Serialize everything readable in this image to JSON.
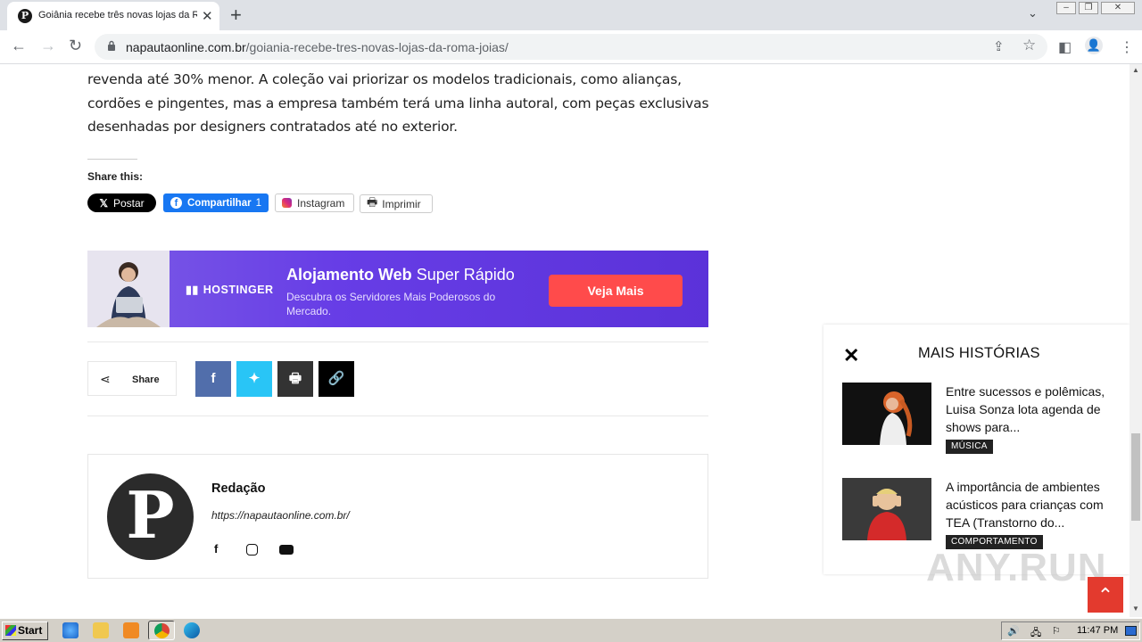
{
  "browser": {
    "tab_title": "Goiânia recebe três novas lojas da Roma Joias",
    "tab_favicon_letter": "P",
    "url_host": "napautaonline.com.br",
    "url_path": "/goiania-recebe-tres-novas-lojas-da-roma-joias/"
  },
  "article": {
    "paragraph_lines": [
      "revenda até 30% menor. A coleção vai priorizar os modelos tradicionais, como alianças,",
      "cordões e pingentes, mas a empresa também terá uma linha autoral, com peças exclusivas",
      "desenhadas por designers contratados até no exterior."
    ],
    "share_this_label": "Share this:",
    "share_buttons": {
      "x_label": "Postar",
      "facebook_label": "Compartilhar",
      "facebook_count": "1",
      "instagram_label": "Instagram",
      "print_label": "Imprimir"
    }
  },
  "ad": {
    "brand": "HOSTINGER",
    "headline_bold": "Alojamento Web",
    "headline_rest": " Super Rápido",
    "subtext": "Descubra os Servidores Mais Poderosos do Mercado.",
    "cta": "Veja Mais"
  },
  "share_bar": {
    "label": "Share"
  },
  "author": {
    "avatar_letter": "P",
    "name": "Redação",
    "site": "https://napautaonline.com.br/"
  },
  "more_stories": {
    "title": "MAIS HISTÓRIAS",
    "items": [
      {
        "title": "Entre sucessos e polêmicas, Luisa Sonza lota agenda de shows para...",
        "category": "MÚSICA"
      },
      {
        "title": "A importância de ambientes acústicos para crianças com TEA (Transtorno do...",
        "category": "COMPORTAMENTO"
      }
    ]
  },
  "watermark": "ANY.RUN",
  "taskbar": {
    "start_label": "Start",
    "clock": "11:47 PM"
  },
  "colors": {
    "facebook": "#1877f2",
    "banner_purple": "#673de6",
    "cta_red": "#ff4b4b",
    "totop_red": "#e33a2e"
  }
}
